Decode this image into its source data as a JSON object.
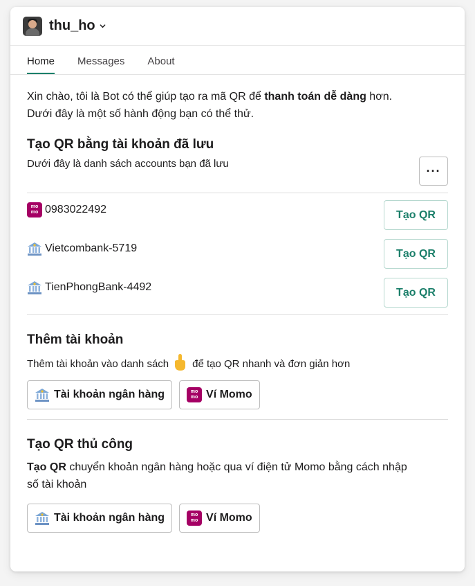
{
  "app": {
    "name": "thu_ho"
  },
  "tabs": [
    {
      "label": "Home"
    },
    {
      "label": "Messages"
    },
    {
      "label": "About"
    }
  ],
  "intro": {
    "line1_a": "Xin chào, tôi là Bot có thể giúp tạo ra mã QR để ",
    "line1_bold": "thanh toán dễ dàng",
    "line1_b": " hơn.",
    "line2": "Dưới đây là một số hành động bạn có thể thử."
  },
  "saved": {
    "title": "Tạo QR bằng tài khoản đã lưu",
    "subtitle": "Dưới đây là danh sách accounts bạn đã lưu",
    "more_label": "···",
    "accounts": [
      {
        "icon": "momo-icon",
        "name": "0983022492",
        "button": "Tạo QR"
      },
      {
        "icon": "bank-icon",
        "name": "Vietcombank-5719",
        "button": "Tạo QR"
      },
      {
        "icon": "bank-icon",
        "name": "TienPhongBank-4492",
        "button": "Tạo QR"
      }
    ]
  },
  "add": {
    "title": "Thêm tài khoản",
    "text_a": "Thêm tài khoản vào danh sách",
    "text_b": "để tạo QR nhanh và đơn giản hơn",
    "bank_button": "Tài khoản ngân hàng",
    "momo_button": "Ví Momo"
  },
  "manual": {
    "title": "Tạo QR thủ công",
    "text_bold": "Tạo QR",
    "text_a": " chuyển khoản ngân hàng hoặc qua ví điện tử Momo bằng cách nhập",
    "text_b": "số tài khoản",
    "bank_button": "Tài khoản ngân hàng",
    "momo_button": "Ví Momo"
  },
  "colors": {
    "accent": "#1b7f6a",
    "momo": "#a50064",
    "hand": "#f5b82e"
  },
  "momo_icon_text": "mo mo"
}
